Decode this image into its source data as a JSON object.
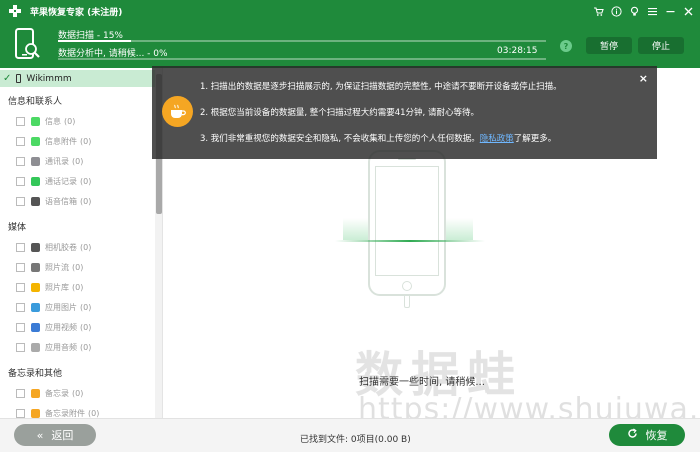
{
  "titlebar": {
    "title": "苹果恢复专家 (未注册)",
    "icons": [
      "cart-icon",
      "info-icon",
      "bulb-icon",
      "menu-icon",
      "minimize-icon",
      "close-icon"
    ]
  },
  "progress": {
    "scan_label": "数据扫描 - 15%",
    "scan_percent": 15,
    "analysis_label": "数据分析中, 请稍候... - 0%",
    "analysis_percent": 0,
    "elapsed": "03:28:15",
    "pause_label": "暂停",
    "stop_label": "停止"
  },
  "sidebar": {
    "device_name": "Wikimmm",
    "sections": [
      {
        "title": "信息和联系人",
        "items": [
          {
            "label": "信息",
            "count": "(0)",
            "icon_color": "#4cd964",
            "icon": "message-icon"
          },
          {
            "label": "信息附件",
            "count": "(0)",
            "icon_color": "#4cd964",
            "icon": "message-attachment-icon"
          },
          {
            "label": "通讯录",
            "count": "(0)",
            "icon_color": "#8e8e93",
            "icon": "contacts-icon"
          },
          {
            "label": "通话记录",
            "count": "(0)",
            "icon_color": "#34c759",
            "icon": "phone-icon"
          },
          {
            "label": "语音信箱",
            "count": "(0)",
            "icon_color": "#555555",
            "icon": "voicemail-icon"
          }
        ]
      },
      {
        "title": "媒体",
        "items": [
          {
            "label": "相机胶卷",
            "count": "(0)",
            "icon_color": "#555555",
            "icon": "camera-icon"
          },
          {
            "label": "照片流",
            "count": "(0)",
            "icon_color": "#777777",
            "icon": "photo-stream-icon"
          },
          {
            "label": "照片库",
            "count": "(0)",
            "icon_color": "#f4b400",
            "icon": "photo-library-icon"
          },
          {
            "label": "应用图片",
            "count": "(0)",
            "icon_color": "#3a9bdc",
            "icon": "app-photo-icon"
          },
          {
            "label": "应用视频",
            "count": "(0)",
            "icon_color": "#3a7bd5",
            "icon": "app-video-icon"
          },
          {
            "label": "应用音频",
            "count": "(0)",
            "icon_color": "#aaaaaa",
            "icon": "app-audio-icon"
          }
        ]
      },
      {
        "title": "备忘录和其他",
        "items": [
          {
            "label": "备忘录",
            "count": "(0)",
            "icon_color": "#f5a623",
            "icon": "notes-icon"
          },
          {
            "label": "备忘录附件",
            "count": "(0)",
            "icon_color": "#f5a623",
            "icon": "notes-attachment-icon"
          }
        ]
      }
    ]
  },
  "overlay": {
    "note1": "1. 扫描出的数据是逐步扫描展示的, 为保证扫描数据的完整性, 中途请不要断开设备或停止扫描。",
    "note2": "2. 根据您当前设备的数据量, 整个扫描过程大约需要41分钟, 请耐心等待。",
    "note3_pre": "3. 我们非常重视您的数据安全和隐私, 不会收集和上传您的个人任何数据。",
    "note3_link": "隐私政策",
    "note3_post": "了解更多。"
  },
  "main": {
    "waiting_text": "扫描需要一些时间, 请稍候..."
  },
  "footer": {
    "back_label": "返回",
    "found_text": "已找到文件: 0项目(0.00 B)",
    "recover_label": "恢复"
  },
  "watermark": {
    "cn": "数据蛙",
    "url": "https://www.shujuwa.net"
  },
  "colors": {
    "brand": "#1f8a3b",
    "accent": "#f5a623"
  }
}
